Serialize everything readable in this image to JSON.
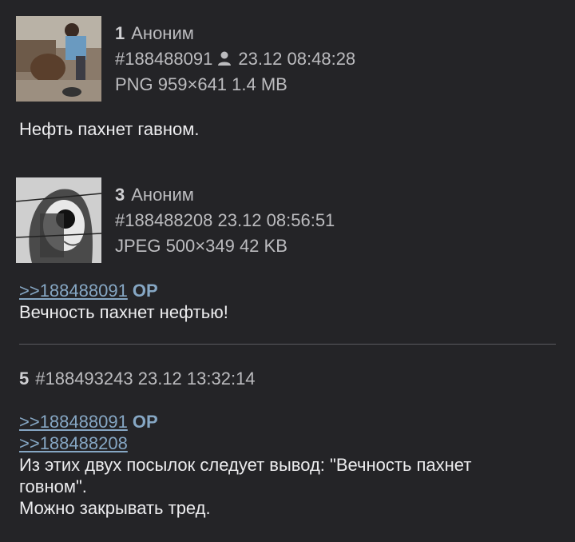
{
  "posts": [
    {
      "num": "1",
      "author": "Аноним",
      "id": "#188488091",
      "datetime": "23.12 08:48:28",
      "file": "PNG 959×641 1.4 MB",
      "text": "Нефть пахнет гавном."
    },
    {
      "num": "3",
      "author": "Аноним",
      "id": "#188488208",
      "datetime": "23.12 08:56:51",
      "file": "JPEG 500×349 42 KB",
      "reply": ">>188488091",
      "op": "OP",
      "text": "Вечность пахнет нефтью!"
    },
    {
      "num": "5",
      "id": "#188493243",
      "datetime": "23.12 13:32:14",
      "reply1": ">>188488091",
      "op": "OP",
      "reply2": ">>188488208",
      "text_line1": "Из этих двух посылок следует вывод: \"Вечность пахнет",
      "text_line2": "говном\".",
      "text_line3": "Можно закрывать тред."
    }
  ],
  "icons": {
    "poster": "person-icon"
  },
  "colors": {
    "background": "#242427",
    "link": "#86a7c4",
    "text": "#ececee",
    "meta": "#bcbcbf"
  }
}
